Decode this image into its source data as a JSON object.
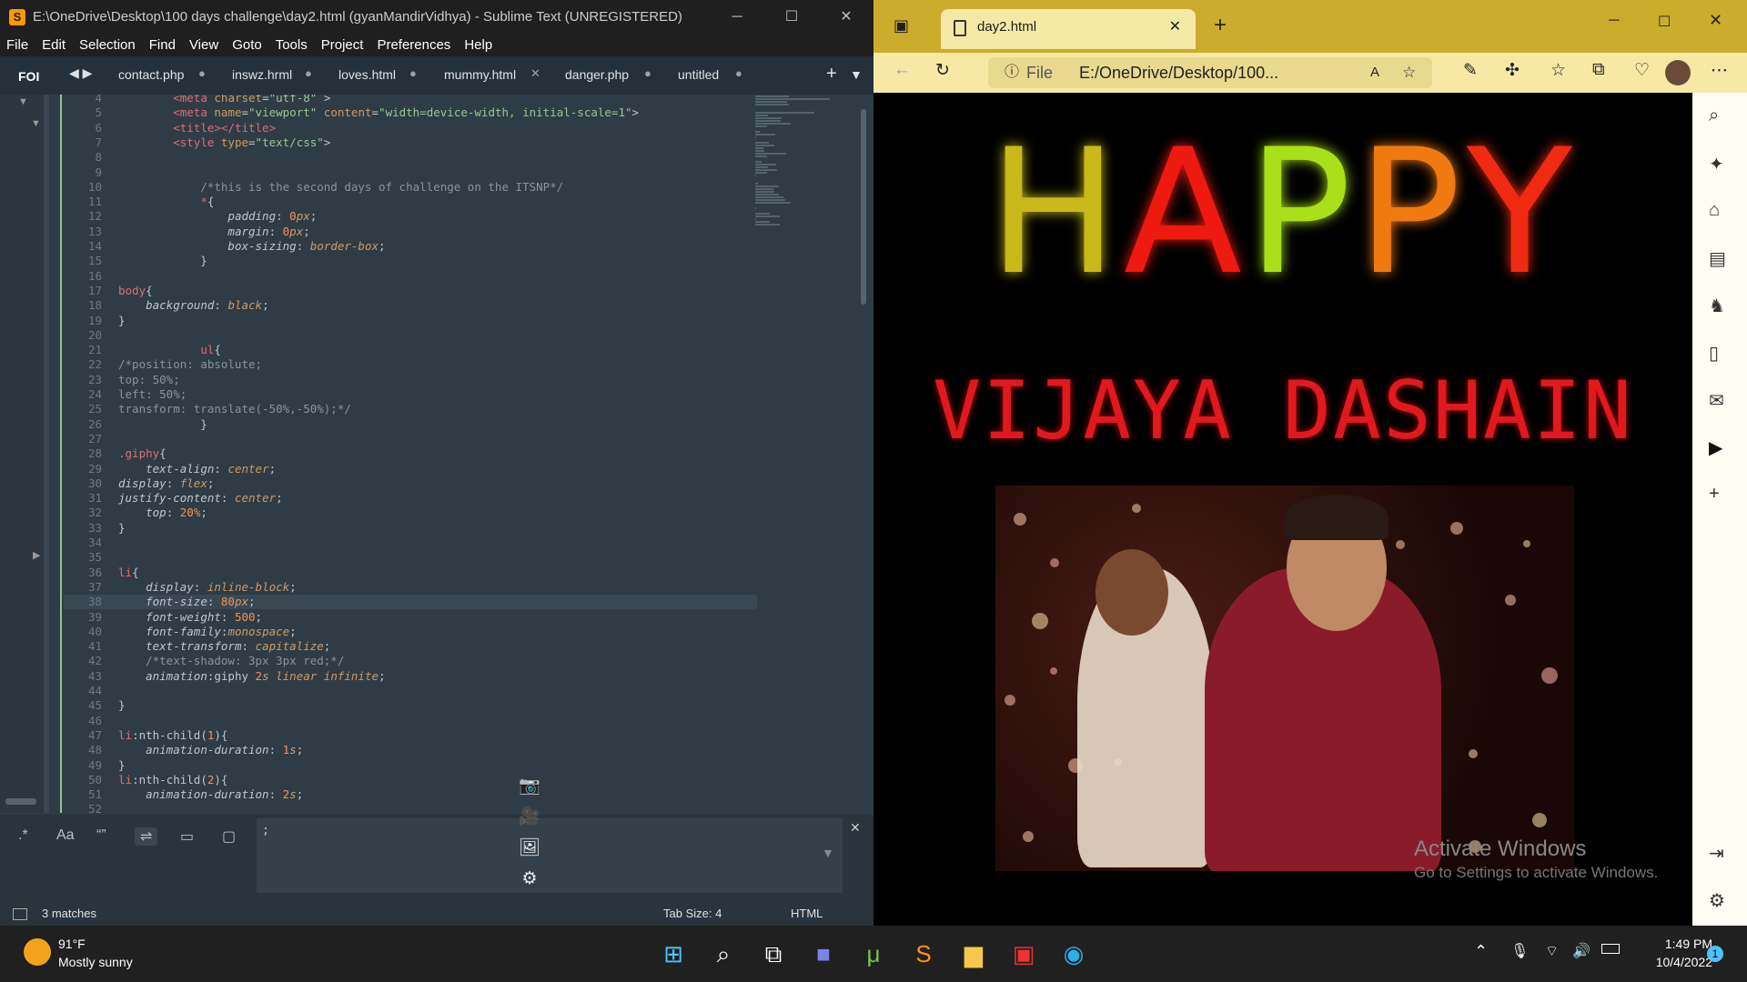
{
  "sublime": {
    "title": "E:\\OneDrive\\Desktop\\100 days challenge\\day2.html (gyanMandirVidhya) - Sublime Text (UNREGISTERED)",
    "menu": [
      "File",
      "Edit",
      "Selection",
      "Find",
      "View",
      "Goto",
      "Tools",
      "Project",
      "Preferences",
      "Help"
    ],
    "sidebar_label": "FOI",
    "tabs": [
      {
        "label": "contact.php",
        "mark": "●"
      },
      {
        "label": "inswz.hrml",
        "mark": "●"
      },
      {
        "label": "loves.html",
        "mark": "●"
      },
      {
        "label": "mummy.html",
        "mark": "✕"
      },
      {
        "label": "danger.php",
        "mark": "●"
      },
      {
        "label": "untitled",
        "mark": "●"
      }
    ],
    "lines": [
      {
        "n": "4",
        "html": "        <span class='c-tag'>&lt;meta</span> <span class='c-at'>charset</span>=<span class='c-str'>\"utf-8\"</span> &gt;"
      },
      {
        "n": "5",
        "html": "        <span class='c-tag'>&lt;meta</span> <span class='c-at'>name</span>=<span class='c-str'>\"viewport\"</span> <span class='c-at'>content</span>=<span class='c-str'>\"width=device-width, initial-scale=1\"</span>&gt;"
      },
      {
        "n": "6",
        "html": "        <span class='c-tag'>&lt;title&gt;&lt;/title&gt;</span>"
      },
      {
        "n": "7",
        "html": "        <span class='c-tag'>&lt;style</span> <span class='c-at'>type</span>=<span class='c-str'>\"text/css\"</span>&gt;"
      },
      {
        "n": "8",
        "html": ""
      },
      {
        "n": "9",
        "html": ""
      },
      {
        "n": "10",
        "html": "            <span class='c-com'>/*this is the second days of challenge on the ITSNP*/</span>"
      },
      {
        "n": "11",
        "html": "            <span class='c-sel'>*</span>{"
      },
      {
        "n": "12",
        "html": "                <span class='c-prop'>padding</span>: <span class='c-num'>0</span><span class='c-val'>px</span>;"
      },
      {
        "n": "13",
        "html": "                <span class='c-prop'>margin</span>: <span class='c-num'>0</span><span class='c-val'>px</span>;"
      },
      {
        "n": "14",
        "html": "                <span class='c-prop'>box-sizing</span>: <span class='c-val'>border-box</span>;"
      },
      {
        "n": "15",
        "html": "            }"
      },
      {
        "n": "16",
        "html": ""
      },
      {
        "n": "17",
        "html": "<span class='c-sel'>body</span>{"
      },
      {
        "n": "18",
        "html": "    <span class='c-prop'>background</span>: <span class='c-val'>black</span>;"
      },
      {
        "n": "19",
        "html": "}"
      },
      {
        "n": "20",
        "html": ""
      },
      {
        "n": "21",
        "html": "            <span class='c-sel'>ul</span>{"
      },
      {
        "n": "22",
        "html": "<span class='c-com'>/*position: absolute;</span>"
      },
      {
        "n": "23",
        "html": "<span class='c-com'>top: 50%;</span>"
      },
      {
        "n": "24",
        "html": "<span class='c-com'>left: 50%;</span>"
      },
      {
        "n": "25",
        "html": "<span class='c-com'>transform: translate(-50%,-50%);*/</span>"
      },
      {
        "n": "26",
        "html": "            }"
      },
      {
        "n": "27",
        "html": ""
      },
      {
        "n": "28",
        "html": "<span class='c-sel'>.giphy</span>{"
      },
      {
        "n": "29",
        "html": "    <span class='c-prop'>text-align</span>: <span class='c-val'>center</span>;"
      },
      {
        "n": "30",
        "html": "<span class='c-prop'>display</span>: <span class='c-val'>flex</span>;"
      },
      {
        "n": "31",
        "html": "<span class='c-prop'>justify-content</span>: <span class='c-val'>center</span>;"
      },
      {
        "n": "32",
        "html": "    <span class='c-prop'>top</span>: <span class='c-num'>20</span><span class='c-val'>%</span>;"
      },
      {
        "n": "33",
        "html": "}"
      },
      {
        "n": "34",
        "html": ""
      },
      {
        "n": "35",
        "html": ""
      },
      {
        "n": "36",
        "html": "<span class='c-sel'>li</span>{"
      },
      {
        "n": "37",
        "html": "    <span class='c-prop'>display</span>: <span class='c-val'>inline-block</span>;"
      },
      {
        "n": "38",
        "html": "    <span class='c-prop'>font-size</span>: <span class='c-num'>80</span><span class='c-val'>px</span>;",
        "cur": true
      },
      {
        "n": "39",
        "html": "    <span class='c-prop'>font-weight</span>: <span class='c-num'>500</span>;"
      },
      {
        "n": "40",
        "html": "    <span class='c-prop'>font-family</span>:<span class='c-val'>monospace</span>;"
      },
      {
        "n": "41",
        "html": "    <span class='c-prop'>text-transform</span>: <span class='c-val'>capitalize</span>;"
      },
      {
        "n": "42",
        "html": "    <span class='c-com'>/*text-shadow: 3px 3px red;*/</span>"
      },
      {
        "n": "43",
        "html": "    <span class='c-prop'>animation</span>:giphy <span class='c-num'>2</span><span class='c-val'>s linear infinite</span>;"
      },
      {
        "n": "44",
        "html": ""
      },
      {
        "n": "45",
        "html": "}"
      },
      {
        "n": "46",
        "html": ""
      },
      {
        "n": "47",
        "html": "<span class='c-sel'>li</span>:nth-child(<span class='c-num'>1</span>){"
      },
      {
        "n": "48",
        "html": "    <span class='c-prop'>animation-duration</span>: <span class='c-num'>1</span><span class='c-val'>s</span>;"
      },
      {
        "n": "49",
        "html": "}"
      },
      {
        "n": "50",
        "html": "<span class='c-sel'>li</span>:nth-child(<span class='c-num'>2</span>){"
      },
      {
        "n": "51",
        "html": "    <span class='c-prop'>animation-duration</span>: <span class='c-num'>2</span><span class='c-val'>s</span>;"
      },
      {
        "n": "52",
        "html": ""
      }
    ],
    "find_value": ";",
    "status_matches": "3 matches",
    "status_tabsize": "Tab Size: 4",
    "status_syntax": "HTML"
  },
  "browser": {
    "tab_title": "day2.html",
    "address_prefix": "File",
    "address": "E:/OneDrive/Desktop/100...",
    "heading_letters": [
      {
        "ch": "H",
        "color": "#c8b81a"
      },
      {
        "ch": "A",
        "color": "#ee1a10"
      },
      {
        "ch": "P",
        "color": "#a8e01a"
      },
      {
        "ch": "P",
        "color": "#f07a10"
      },
      {
        "ch": "Y",
        "color": "#f02a10"
      }
    ],
    "subheading": "VIJAYA DASHAIN",
    "watermark_title": "Activate Windows",
    "watermark_sub": "Go to Settings to activate Windows."
  },
  "taskbar": {
    "temp": "91°F",
    "weather": "Mostly sunny",
    "time": "1:49 PM",
    "date": "10/4/2022",
    "notif_count": "1"
  },
  "colors": {
    "accent": "#ccac2c",
    "editor_bg": "#2f3c45"
  }
}
